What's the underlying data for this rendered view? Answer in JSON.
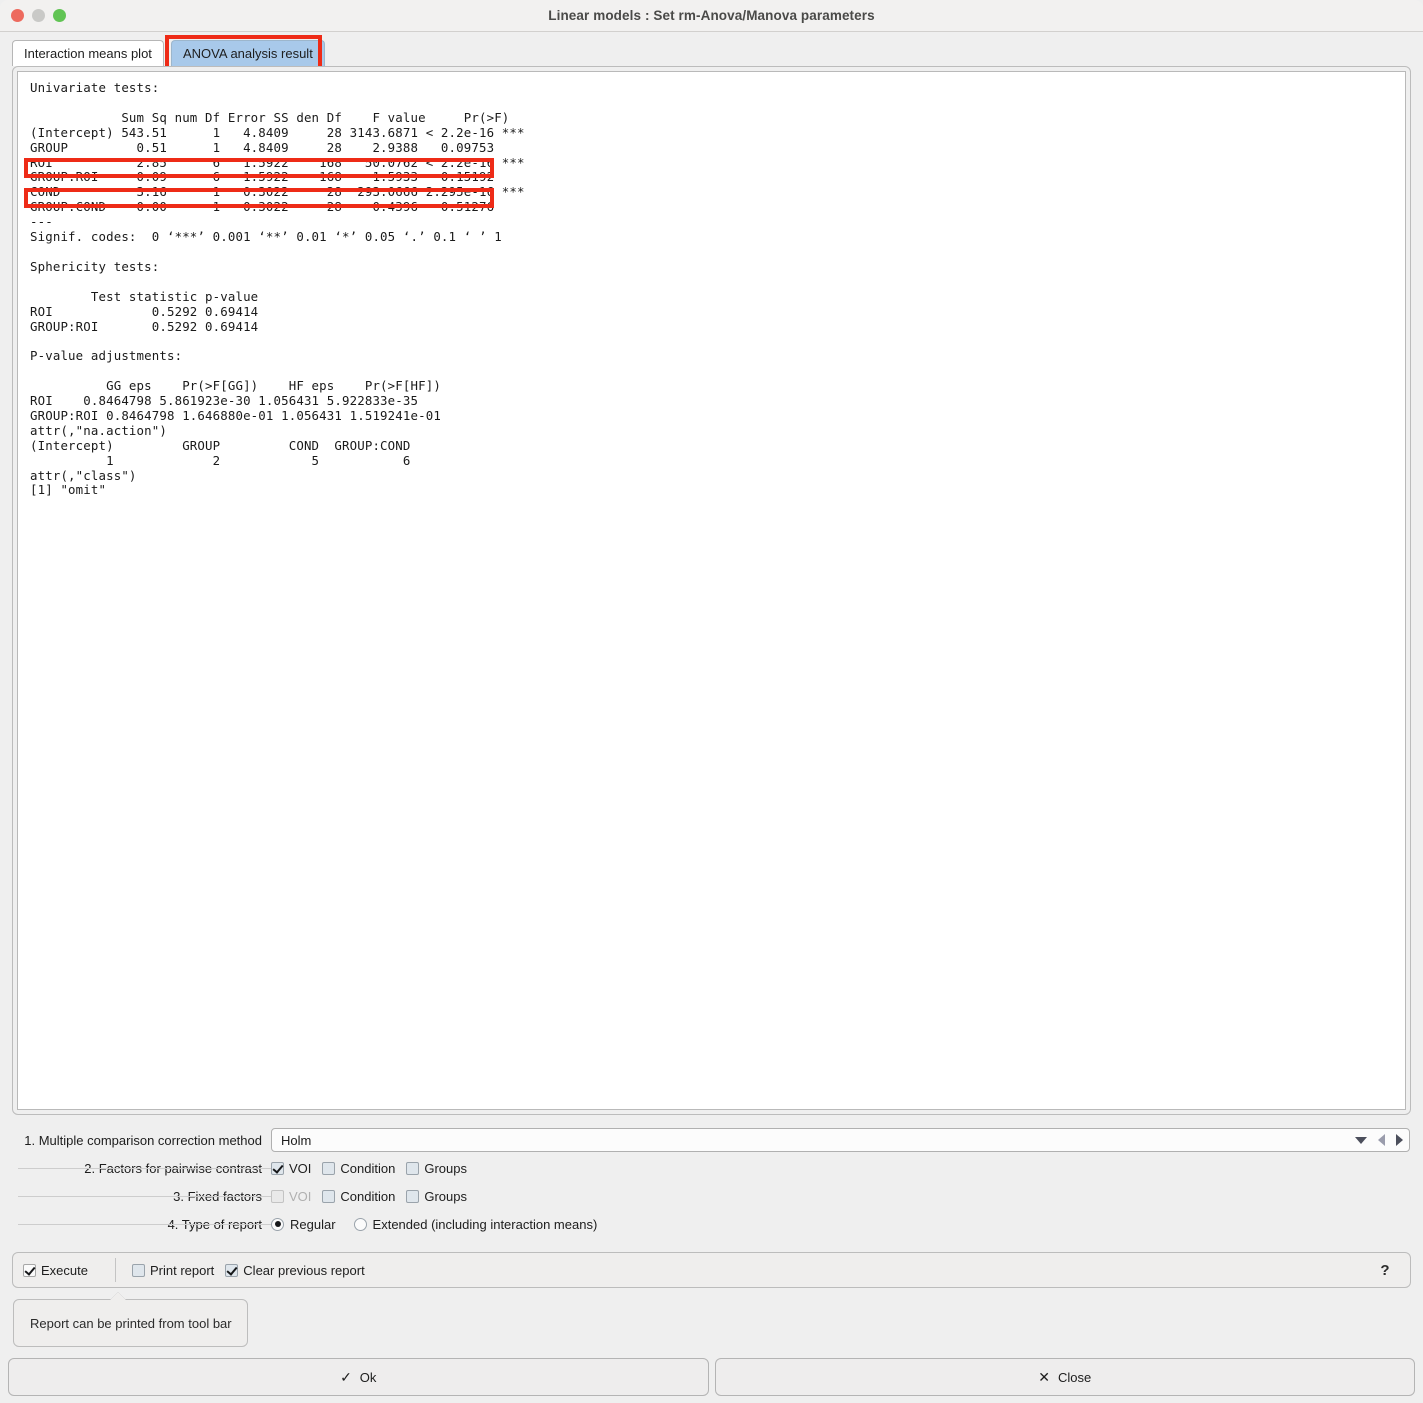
{
  "window": {
    "title": "Linear models :  Set rm-Anova/Manova parameters",
    "traffic": {
      "close": "close-button",
      "minimize": "minimize-button",
      "zoom": "zoom-button"
    }
  },
  "tabs": [
    {
      "label": "Interaction means plot",
      "active": false
    },
    {
      "label": "ANOVA analysis result",
      "active": true
    }
  ],
  "report": {
    "text": "Univariate tests:\n\n            Sum Sq num Df Error SS den Df    F value     Pr(>F)\n(Intercept) 543.51      1   4.8409     28 3143.6871 < 2.2e-16 ***\nGROUP         0.51      1   4.8409     28    2.9388   0.09753\nROI           2.85      6   1.5922    168   50.0762 < 2.2e-16 ***\nGROUP:ROI     0.09      6   1.5922    168    1.5933   0.15192\nCOND          3.16      1   0.3022     28  293.0666 2.295e-16 ***\nGROUP:COND    0.00      1   0.3022     28    0.4396   0.51276\n---\nSignif. codes:  0 ‘***’ 0.001 ‘**’ 0.01 ‘*’ 0.05 ‘.’ 0.1 ‘ ’ 1\n\nSphericity tests:\n\n        Test statistic p-value\nROI             0.5292 0.69414\nGROUP:ROI       0.5292 0.69414\n\nP-value adjustments:\n\n          GG eps    Pr(>F[GG])    HF eps    Pr(>F[HF])\nROI    0.8464798 5.861923e-30 1.056431 5.922833e-35\nGROUP:ROI 0.8464798 1.646880e-01 1.056431 1.519241e-01\nattr(,\"na.action\")\n(Intercept)         GROUP         COND  GROUP:COND\n          1             2            5           6\nattr(,\"class\")\n[1] \"omit\"",
    "highlight_color": "#ee2b17",
    "highlighted_rows": [
      "ROI",
      "COND"
    ]
  },
  "options": {
    "row1": {
      "label": "1. Multiple comparison correction method",
      "value": "Holm"
    },
    "row2": {
      "label": "2. Factors for pairwise contrast",
      "items": [
        {
          "label": "VOI",
          "checked": true,
          "disabled": false
        },
        {
          "label": "Condition",
          "checked": false,
          "disabled": false
        },
        {
          "label": "Groups",
          "checked": false,
          "disabled": false
        }
      ]
    },
    "row3": {
      "label": "3. Fixed factors",
      "items": [
        {
          "label": "VOI",
          "checked": false,
          "disabled": true
        },
        {
          "label": "Condition",
          "checked": false,
          "disabled": false
        },
        {
          "label": "Groups",
          "checked": false,
          "disabled": false
        }
      ]
    },
    "row4": {
      "label": "4. Type of report",
      "items": [
        {
          "label": "Regular",
          "selected": true
        },
        {
          "label": "Extended (including interaction means)",
          "selected": false
        }
      ]
    }
  },
  "exec_bar": {
    "execute": {
      "label": "Execute",
      "checked": true
    },
    "print_report": {
      "label": "Print report",
      "checked": false
    },
    "clear_previous": {
      "label": "Clear previous report",
      "checked": true
    },
    "help": "?"
  },
  "tooltip": {
    "text": "Report can be printed from tool bar"
  },
  "buttons": {
    "ok": {
      "label": "Ok",
      "glyph": "✓"
    },
    "close": {
      "label": "Close",
      "glyph": "✕"
    }
  }
}
